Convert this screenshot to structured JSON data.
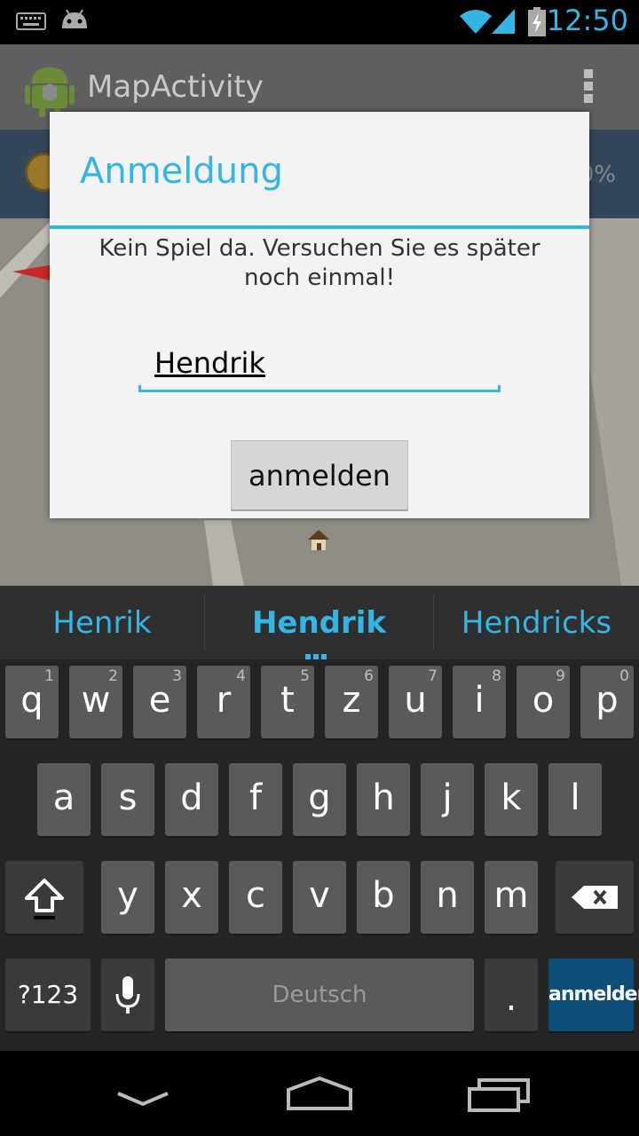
{
  "status_bar": {
    "time": "12:50"
  },
  "app": {
    "title": "MapActivity",
    "info_percent": "0%"
  },
  "dialog": {
    "title": "Anmeldung",
    "message": "Kein Spiel da. Versuchen Sie es später noch einmal!",
    "name_value": "Hendrik",
    "button_label": "anmelden"
  },
  "suggestions": [
    "Henrik",
    "Hendrik",
    "Hendricks"
  ],
  "keyboard": {
    "row1": [
      {
        "k": "q",
        "h": "1"
      },
      {
        "k": "w",
        "h": "2"
      },
      {
        "k": "e",
        "h": "3"
      },
      {
        "k": "r",
        "h": "4"
      },
      {
        "k": "t",
        "h": "5"
      },
      {
        "k": "z",
        "h": "6"
      },
      {
        "k": "u",
        "h": "7"
      },
      {
        "k": "i",
        "h": "8"
      },
      {
        "k": "o",
        "h": "9"
      },
      {
        "k": "p",
        "h": "0"
      }
    ],
    "row2": [
      "a",
      "s",
      "d",
      "f",
      "g",
      "h",
      "j",
      "k",
      "l"
    ],
    "row3": [
      "y",
      "x",
      "c",
      "v",
      "b",
      "n",
      "m"
    ],
    "symbols_label": "?123",
    "space_label": "Deutsch",
    "period_label": ".",
    "action_label": "anmelden"
  },
  "colors": {
    "accent": "#33b5e5",
    "action_key": "#0e4d78"
  },
  "icons": [
    "keyboard-icon",
    "android-icon",
    "wifi-icon",
    "signal-icon",
    "battery-icon",
    "app-icon",
    "overflow-icon",
    "shift-icon",
    "backspace-icon",
    "mic-icon",
    "back-icon",
    "home-icon",
    "recents-icon"
  ]
}
